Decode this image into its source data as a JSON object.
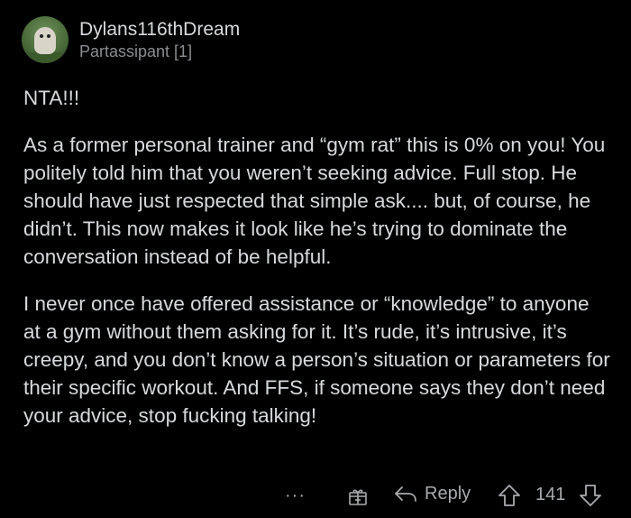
{
  "comment": {
    "author": "Dylans116thDream",
    "flair": "Partassipant [1]",
    "paragraphs": [
      "NTA!!!",
      "As a former personal trainer and “gym rat” this is 0% on you! You politely told him that you weren’t seeking advice. Full stop. He should have just respected that simple ask.... but, of course, he didn’t. This now makes it look like he’s trying to dominate the conversation instead of be helpful.",
      "I never once have offered assistance or “knowledge” to anyone at a gym without them asking for it. It’s rude, it’s intrusive, it’s creepy, and you don’t know a person’s situation or parameters for their specific workout. And FFS, if someone says they don’t need your advice, stop fucking talking!"
    ]
  },
  "actions": {
    "more": "···",
    "award_icon": "gift-icon",
    "reply_label": "Reply",
    "score": "141"
  },
  "colors": {
    "background": "#000000",
    "text": "#d7dadc",
    "muted": "#8a8d90"
  }
}
